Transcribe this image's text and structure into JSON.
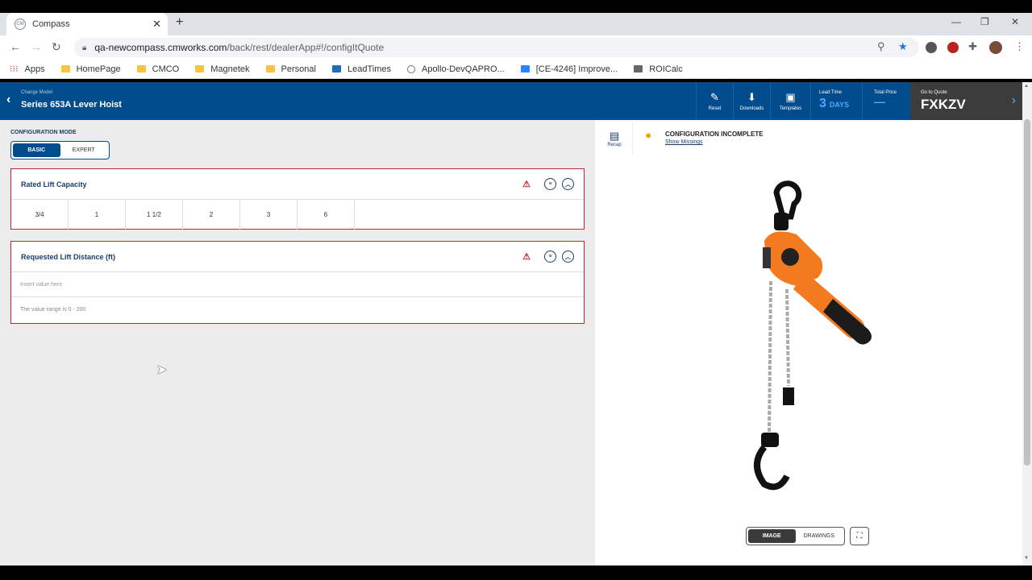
{
  "browser": {
    "tab_title": "Compass",
    "new_tab": "+",
    "url_host": "qa-newcompass.cmworks.com",
    "url_path": "/back/rest/dealerApp#!/configItQuote",
    "bookmarks": [
      "Apps",
      "HomePage",
      "CMCO",
      "Magnetek",
      "Personal",
      "LeadTimes",
      "Apollo-DevQAPRO...",
      "[CE-4246] Improve...",
      "ROICalc"
    ]
  },
  "header": {
    "subtitle": "Change Model",
    "title": "Series 653A Lever Hoist",
    "buttons": [
      {
        "label": "Reset",
        "icon": "eraser-icon"
      },
      {
        "label": "Downloads",
        "icon": "download-icon"
      },
      {
        "label": "Templates",
        "icon": "save-icon"
      }
    ],
    "lead_time_label": "Lead Time",
    "lead_time_value": "3",
    "lead_time_unit": "DAYS",
    "total_price_label": "Total Price",
    "total_price_value": "—",
    "go_to_quote_label": "Go to Quote",
    "quote_id": "FXKZV"
  },
  "config": {
    "mode_label": "CONFIGURATION MODE",
    "modes": [
      "BASIC",
      "EXPERT"
    ],
    "active_mode": "BASIC"
  },
  "rated_lift": {
    "title": "Rated Lift Capacity",
    "options": [
      "3/4",
      "1",
      "1 1/2",
      "2",
      "3",
      "6"
    ]
  },
  "lift_distance": {
    "title": "Requested Lift Distance (ft)",
    "placeholder": "Insert value here",
    "range_text": "The value range is 0 - 200"
  },
  "right_panel": {
    "recap_label": "Recap",
    "status_title": "CONFIGURATION INCOMPLETE",
    "show_missings": "Show Missings",
    "view_modes": [
      "IMAGE",
      "DRAWINGS"
    ],
    "active_view": "IMAGE"
  },
  "colors": {
    "brand_blue": "#004c8c",
    "accent_blue": "#4ea8ff",
    "error_red": "#c0242c",
    "hoist_orange": "#f47a1f"
  }
}
